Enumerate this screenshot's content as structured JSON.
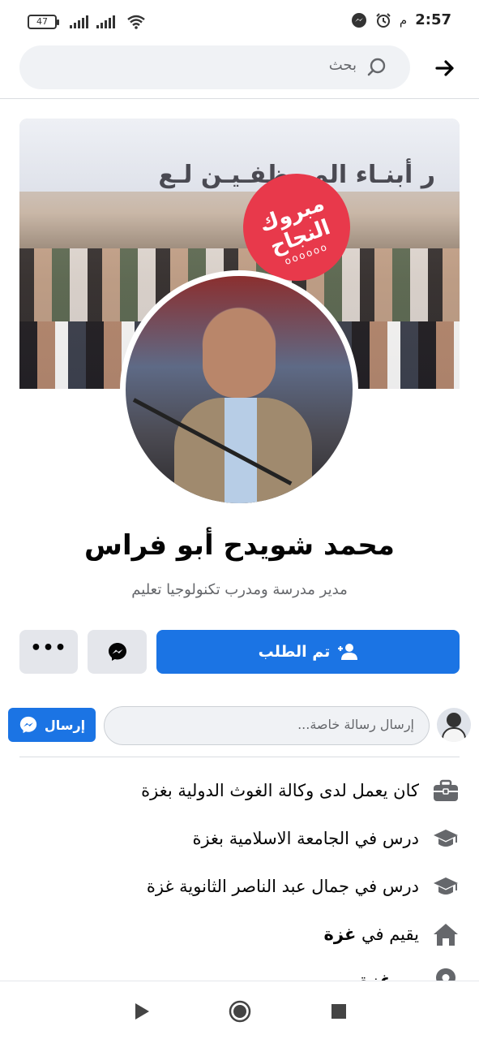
{
  "status_bar": {
    "time": "2:57",
    "ampm": "م",
    "battery": "47"
  },
  "search": {
    "placeholder": "بحث"
  },
  "cover": {
    "banner_text": "ر أبنـاء المـوظفـيـن لـع",
    "sticker_text": "مبروك النجاح",
    "sticker_dots": "oooooo"
  },
  "profile": {
    "name": "محمد شويدح أبو فراس",
    "bio": "مدير مدرسة ومدرب تكنولوجيا تعليم"
  },
  "actions": {
    "request_label": "تم الطلب",
    "more_label": "•••"
  },
  "message": {
    "placeholder": "إرسال رسالة خاصة...",
    "send_label": "إرسال"
  },
  "intro": [
    {
      "icon": "briefcase-icon",
      "text": "كان يعمل لدى وكالة الغوث الدولية بغزة"
    },
    {
      "icon": "graduation-cap-icon",
      "text": "درس في الجامعة الاسلامية بغزة"
    },
    {
      "icon": "graduation-cap-icon",
      "text": "درس في جمال عبد الناصر الثانوية غزة"
    },
    {
      "icon": "home-icon",
      "prefix": "يقيم في ",
      "place": "غزة"
    },
    {
      "icon": "location-pin-icon",
      "prefix": "من ",
      "place": "غزة"
    }
  ],
  "colors": {
    "primary": "#1b74e4",
    "secondary_bg": "#e4e6eb",
    "text_secondary": "#65676b"
  }
}
